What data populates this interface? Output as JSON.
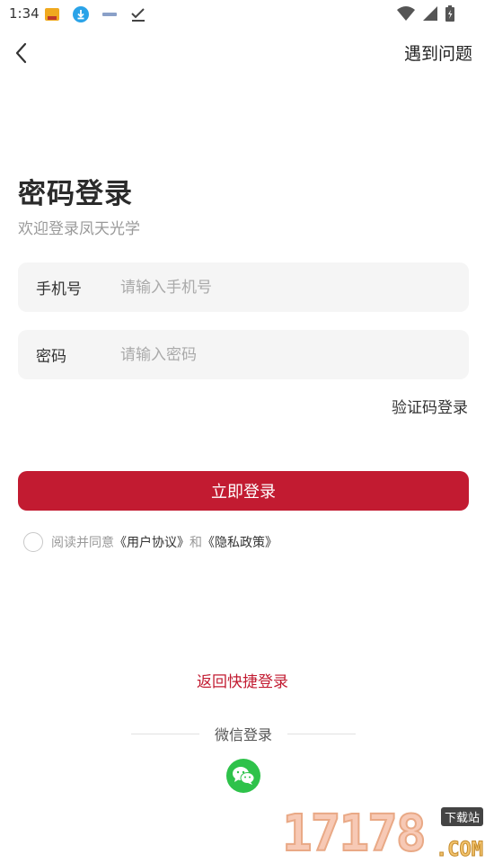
{
  "status_bar": {
    "time": "1:34",
    "left_icons": [
      "app-notification-icon",
      "download-icon",
      "app-notification-icon",
      "check-icon"
    ],
    "right_icons": [
      "wifi-icon",
      "cell-signal-icon",
      "battery-icon"
    ]
  },
  "nav": {
    "help_label": "遇到问题"
  },
  "header": {
    "title": "密码登录",
    "subtitle": "欢迎登录凤天光学"
  },
  "form": {
    "phone_label": "手机号",
    "phone_placeholder": "请输入手机号",
    "phone_value": "",
    "password_label": "密码",
    "password_placeholder": "请输入密码",
    "password_value": "",
    "sms_login_label": "验证码登录",
    "submit_label": "立即登录"
  },
  "agreement": {
    "prefix": "阅读并同意",
    "user_agreement": "《用户协议》",
    "conjunction": "和",
    "privacy_policy": "《隐私政策》",
    "checked": false
  },
  "alt_login": {
    "quick_login_label": "返回快捷登录",
    "wechat_label": "微信登录"
  },
  "watermark": {
    "digits": "17178",
    "badge": "下载站",
    "domain": ".COM"
  },
  "colors": {
    "brand": "#c21b31",
    "wechat": "#2ec24a",
    "field_bg": "#f5f5f5"
  }
}
